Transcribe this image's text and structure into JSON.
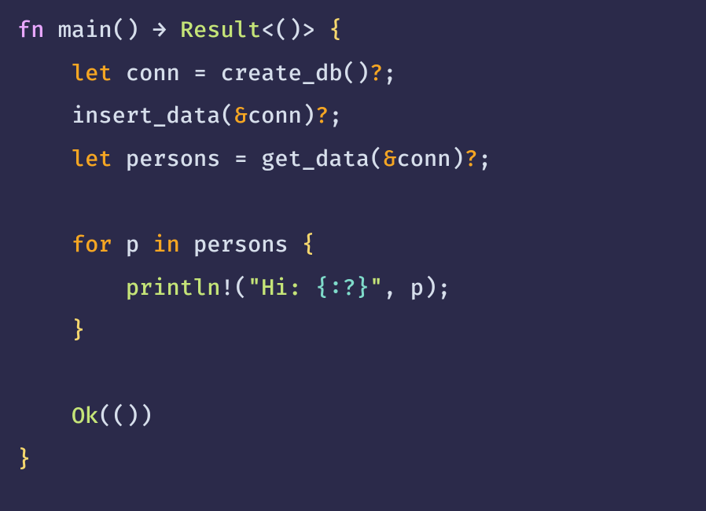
{
  "code": {
    "lines": [
      {
        "tokens": [
          {
            "cls": "kw-fn",
            "text": "fn"
          },
          {
            "cls": "punct",
            "text": " "
          },
          {
            "cls": "fn-name",
            "text": "main"
          },
          {
            "cls": "paren",
            "text": "()"
          },
          {
            "cls": "punct",
            "text": " "
          },
          {
            "cls": "op-arrow",
            "text": "→"
          },
          {
            "cls": "punct",
            "text": " "
          },
          {
            "cls": "type-name",
            "text": "Result"
          },
          {
            "cls": "punct",
            "text": "<()> "
          },
          {
            "cls": "brace",
            "text": "{"
          }
        ]
      },
      {
        "tokens": [
          {
            "cls": "punct",
            "text": "    "
          },
          {
            "cls": "kw-let",
            "text": "let"
          },
          {
            "cls": "punct",
            "text": " "
          },
          {
            "cls": "ident",
            "text": "conn"
          },
          {
            "cls": "punct",
            "text": " "
          },
          {
            "cls": "op-eq",
            "text": "="
          },
          {
            "cls": "punct",
            "text": " "
          },
          {
            "cls": "fn-call",
            "text": "create_db"
          },
          {
            "cls": "paren",
            "text": "()"
          },
          {
            "cls": "op-question",
            "text": "?"
          },
          {
            "cls": "punct",
            "text": ";"
          }
        ]
      },
      {
        "tokens": [
          {
            "cls": "punct",
            "text": "    "
          },
          {
            "cls": "fn-call",
            "text": "insert_data"
          },
          {
            "cls": "paren",
            "text": "("
          },
          {
            "cls": "op-amp",
            "text": "&"
          },
          {
            "cls": "ident",
            "text": "conn"
          },
          {
            "cls": "paren",
            "text": ")"
          },
          {
            "cls": "op-question",
            "text": "?"
          },
          {
            "cls": "punct",
            "text": ";"
          }
        ]
      },
      {
        "tokens": [
          {
            "cls": "punct",
            "text": "    "
          },
          {
            "cls": "kw-let",
            "text": "let"
          },
          {
            "cls": "punct",
            "text": " "
          },
          {
            "cls": "ident",
            "text": "persons"
          },
          {
            "cls": "punct",
            "text": " "
          },
          {
            "cls": "op-eq",
            "text": "="
          },
          {
            "cls": "punct",
            "text": " "
          },
          {
            "cls": "fn-call",
            "text": "get_data"
          },
          {
            "cls": "paren",
            "text": "("
          },
          {
            "cls": "op-amp",
            "text": "&"
          },
          {
            "cls": "ident",
            "text": "conn"
          },
          {
            "cls": "paren",
            "text": ")"
          },
          {
            "cls": "op-question",
            "text": "?"
          },
          {
            "cls": "punct",
            "text": ";"
          }
        ]
      },
      {
        "tokens": []
      },
      {
        "tokens": [
          {
            "cls": "punct",
            "text": "    "
          },
          {
            "cls": "kw-for",
            "text": "for"
          },
          {
            "cls": "punct",
            "text": " "
          },
          {
            "cls": "ident",
            "text": "p"
          },
          {
            "cls": "punct",
            "text": " "
          },
          {
            "cls": "kw-in",
            "text": "in"
          },
          {
            "cls": "punct",
            "text": " "
          },
          {
            "cls": "ident",
            "text": "persons"
          },
          {
            "cls": "punct",
            "text": " "
          },
          {
            "cls": "brace",
            "text": "{"
          }
        ]
      },
      {
        "tokens": [
          {
            "cls": "punct",
            "text": "        "
          },
          {
            "cls": "macro",
            "text": "println"
          },
          {
            "cls": "op-excl",
            "text": "!"
          },
          {
            "cls": "paren",
            "text": "("
          },
          {
            "cls": "string",
            "text": "\"Hi: "
          },
          {
            "cls": "string-fmt",
            "text": "{:?}"
          },
          {
            "cls": "string",
            "text": "\""
          },
          {
            "cls": "punct",
            "text": ", p"
          },
          {
            "cls": "paren",
            "text": ")"
          },
          {
            "cls": "punct",
            "text": ";"
          }
        ]
      },
      {
        "tokens": [
          {
            "cls": "punct",
            "text": "    "
          },
          {
            "cls": "brace",
            "text": "}"
          }
        ]
      },
      {
        "tokens": []
      },
      {
        "tokens": [
          {
            "cls": "punct",
            "text": "    "
          },
          {
            "cls": "ok-type",
            "text": "Ok"
          },
          {
            "cls": "paren",
            "text": "(())"
          }
        ]
      },
      {
        "tokens": [
          {
            "cls": "brace",
            "text": "}"
          }
        ]
      }
    ]
  }
}
